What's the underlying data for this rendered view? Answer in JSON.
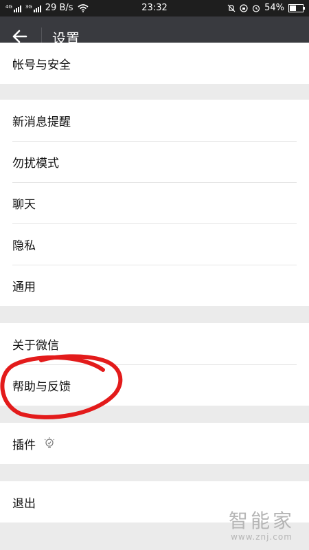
{
  "status_bar": {
    "sim1_label": "4G",
    "sim2_label": "3G",
    "speed": "29 B/s",
    "time": "23:32",
    "battery": "54%",
    "battery_level": 0.54
  },
  "header": {
    "title": "设置",
    "back_icon": "arrow-left-icon"
  },
  "groups": [
    {
      "items": [
        {
          "label": "帐号与安全"
        }
      ]
    },
    {
      "items": [
        {
          "label": "新消息提醒"
        },
        {
          "label": "勿扰模式"
        },
        {
          "label": "聊天"
        },
        {
          "label": "隐私"
        },
        {
          "label": "通用"
        }
      ]
    },
    {
      "items": [
        {
          "label": "关于微信"
        },
        {
          "label": "帮助与反馈"
        }
      ]
    },
    {
      "items": [
        {
          "label": "插件",
          "icon": "lightbulb-icon"
        }
      ]
    },
    {
      "items": [
        {
          "label": "退出"
        }
      ]
    }
  ],
  "annotation": {
    "color": "#e31b1b"
  },
  "watermark": {
    "brand": "智能家",
    "url": "www.znj.com"
  },
  "colors": {
    "app_bar": "#393a3f",
    "status_bar": "#1e1e1e",
    "background": "#ebebeb"
  }
}
